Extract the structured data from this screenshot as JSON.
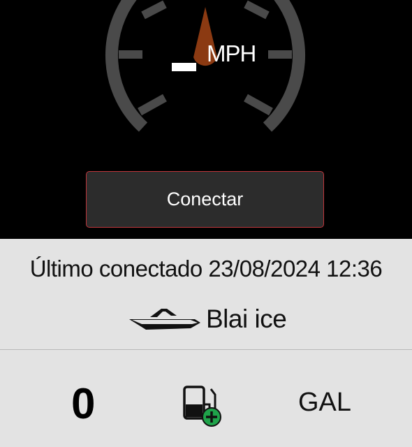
{
  "speedometer": {
    "value": "_",
    "unit": "MPH"
  },
  "connect_button": {
    "label": "Conectar"
  },
  "info": {
    "last_connected": "Último conectado 23/08/2024 12:36",
    "boat_name": "Blai ice"
  },
  "fuel": {
    "value": "0",
    "unit": "GAL",
    "icon": "fuel-add-icon"
  },
  "colors": {
    "needle": "#8b3a12",
    "accent_border": "#c0363c",
    "add_badge": "#1fa34a"
  }
}
